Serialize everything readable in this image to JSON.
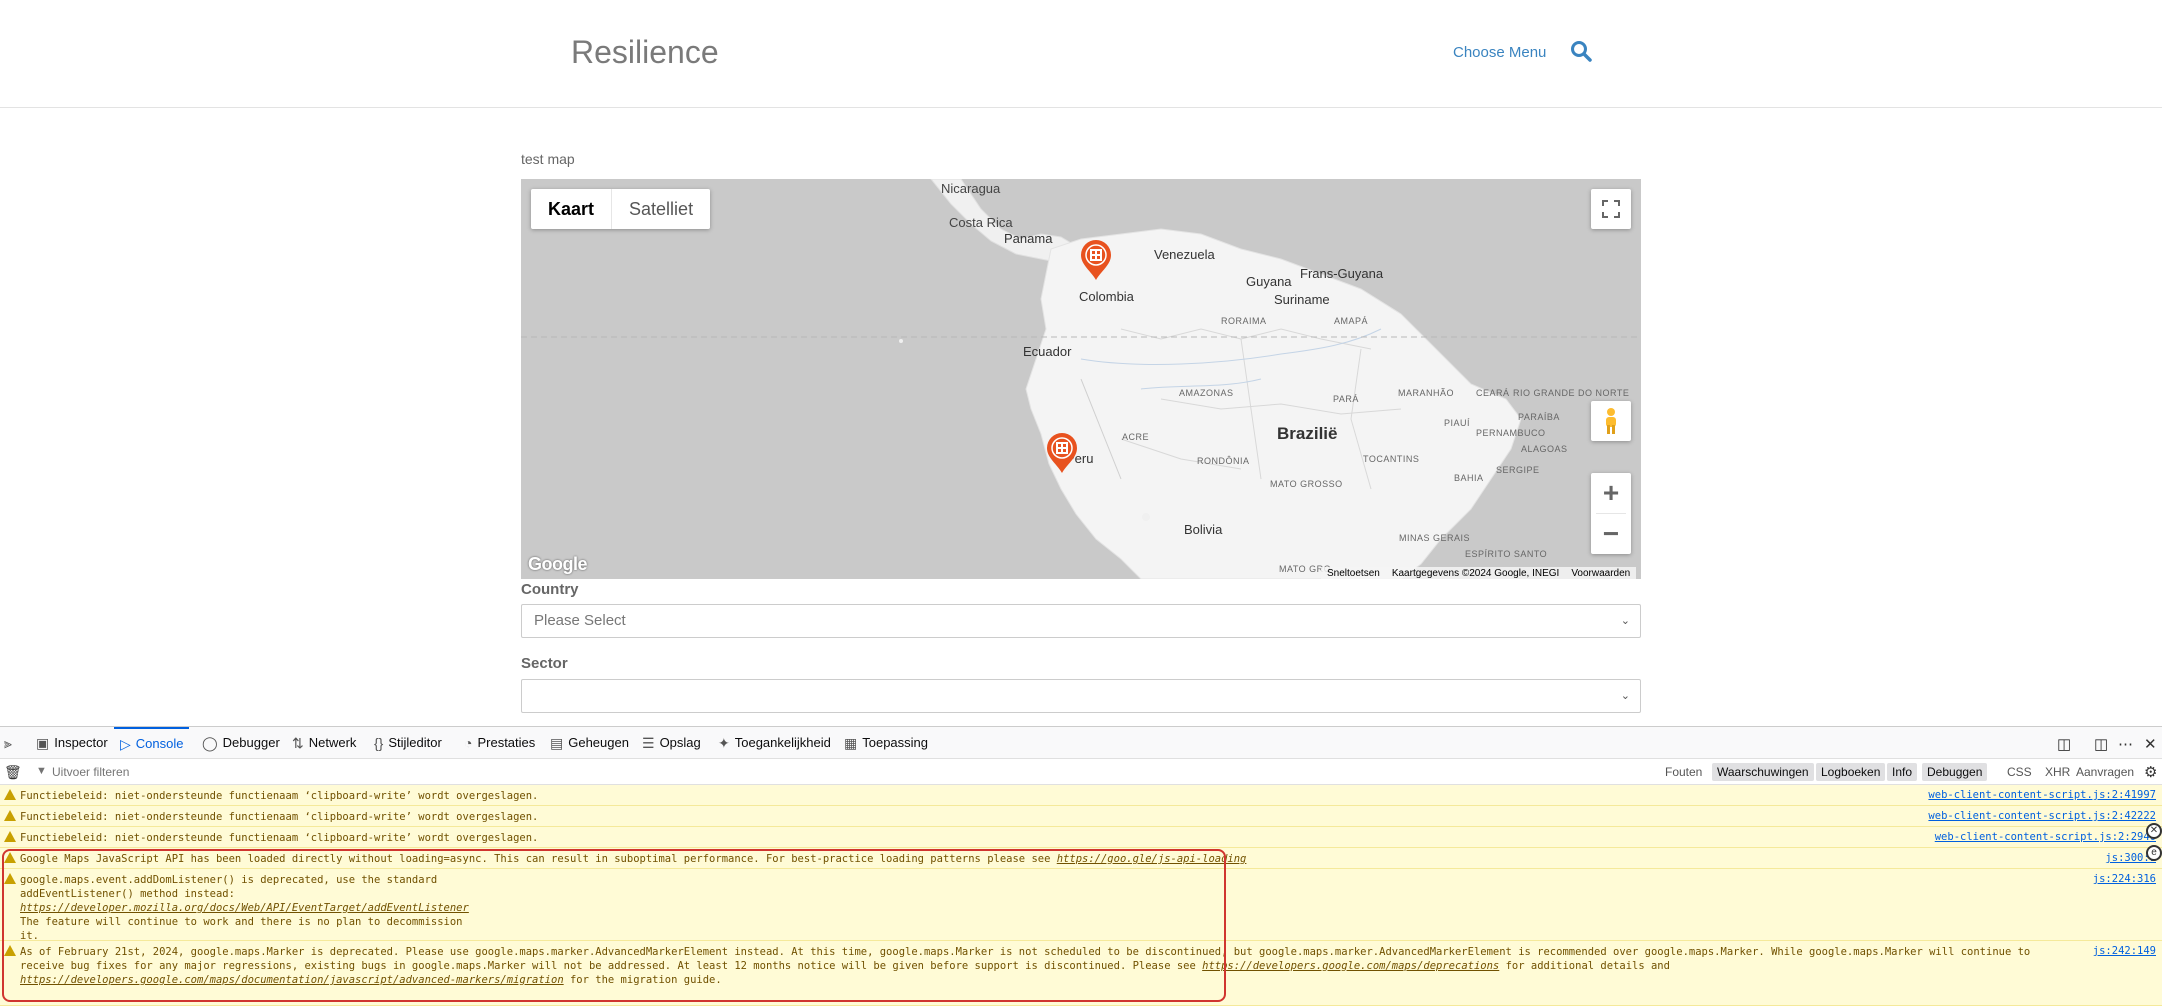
{
  "header": {
    "site_title": "Resilience",
    "menu_link": "Choose Menu",
    "search_icon": "search-icon"
  },
  "map": {
    "caption": "test map",
    "type_buttons": [
      "Kaart",
      "Satelliet"
    ],
    "active_type": "Kaart",
    "labels": {
      "nicaragua": "Nicaragua",
      "costa_rica": "Costa Rica",
      "panama": "Panama",
      "venezuela": "Venezuela",
      "colombia": "Colombia",
      "guyana": "Guyana",
      "frans_guyana": "Frans-Guyana",
      "suriname": "Suriname",
      "roraima": "RORAIMA",
      "amapa": "AMAPÁ",
      "ecuador": "Ecuador",
      "amazonas": "AMAZONAS",
      "para": "PARÁ",
      "maranhao": "MARANHÃO",
      "ceara": "CEARÁ",
      "rio_grande_do_norte": "RIO GRANDE DO NORTE",
      "paraiba": "PARAÍBA",
      "piaui": "PIAUÍ",
      "pernambuco": "PERNAMBUCO",
      "alagoas": "ALAGOAS",
      "sergipe": "SERGIPE",
      "bahia": "BAHIA",
      "tocantins": "TOCANTINS",
      "acre": "ACRE",
      "rondonia": "RONDÔNIA",
      "brazilie": "Brazilië",
      "peru": "Peru",
      "mato_grosso": "MATO GROSSO",
      "bolivia": "Bolivia",
      "minas_gerais": "MINAS GERAIS",
      "espirito_santo": "ESPÍRITO SANTO",
      "mato_grosso_do_sul": "MATO GRO..."
    },
    "logo_text": "Google",
    "attribution": [
      "Sneltoetsen",
      "Kaartgegevens ©2024 Google, INEGI",
      "Voorwaarden"
    ],
    "controls": {
      "fullscreen": "fullscreen-icon",
      "streetview": "pegman-icon",
      "zoom_in": "+",
      "zoom_out": "−"
    },
    "marker_icon": "building-marker-icon",
    "marker_color": "#e8521f"
  },
  "form": {
    "country_label": "Country",
    "country_value": "Please Select",
    "sector_label": "Sector",
    "sector_value": ""
  },
  "devtools": {
    "tabs": [
      "Inspector",
      "Console",
      "Debugger",
      "Netwerk",
      "Stijleditor",
      "Prestaties",
      "Geheugen",
      "Opslag",
      "Toegankelijkheid",
      "Toepassing"
    ],
    "active_tab": "Console",
    "filter_placeholder": "Uitvoer filteren",
    "filters": [
      "Fouten",
      "Waarschuwingen",
      "Logboeken",
      "Info",
      "Debuggen",
      "CSS",
      "XHR",
      "Aanvragen"
    ],
    "active_filters": [
      "Waarschuwingen",
      "Logboeken",
      "Info",
      "Debuggen"
    ],
    "logs": [
      {
        "text": "Functiebeleid: niet-ondersteunde functienaam ‘clipboard-write’ wordt overgeslagen.",
        "source": "web-client-content-script.js:2:41997"
      },
      {
        "text": "Functiebeleid: niet-ondersteunde functienaam ‘clipboard-write’ wordt overgeslagen.",
        "source": "web-client-content-script.js:2:42222"
      },
      {
        "text": "Functiebeleid: niet-ondersteunde functienaam ‘clipboard-write’ wordt overgeslagen.",
        "source": "web-client-content-script.js:2:2946"
      },
      {
        "text": "Google Maps JavaScript API has been loaded directly without loading=async. This can result in suboptimal performance. For best-practice loading patterns please see ",
        "link": "https://goo.gle/js-api-loading",
        "source": "js:300:1"
      },
      {
        "text1": "google.maps.event.addDomListener() is deprecated, use the standard\naddEventListener() method instead:",
        "link": "https://developer.mozilla.org/docs/Web/API/EventTarget/addEventListener",
        "text2": "The feature will continue to work and there is no plan to decommission\nit.",
        "source": "js:224:316"
      },
      {
        "text1": "As of February 21st, 2024, google.maps.Marker is deprecated. Please use google.maps.marker.AdvancedMarkerElement instead. At this time, google.maps.Marker is not scheduled to be discontinued, but google.maps.marker.AdvancedMarkerElement is recommended over google.maps.Marker. While google.maps.Marker will continue to receive bug fixes for any major regressions, existing bugs in google.maps.Marker will not be addressed. At least 12 months notice will be given before support is discontinued. Please see ",
        "link1": "https://developers.google.com/maps/deprecations",
        "text2": " for additional details and ",
        "link2": "https://developers.google.com/maps/documentation/javascript/advanced-markers/migration",
        "text3": " for the migration guide.",
        "source": "js:242:149"
      }
    ]
  }
}
